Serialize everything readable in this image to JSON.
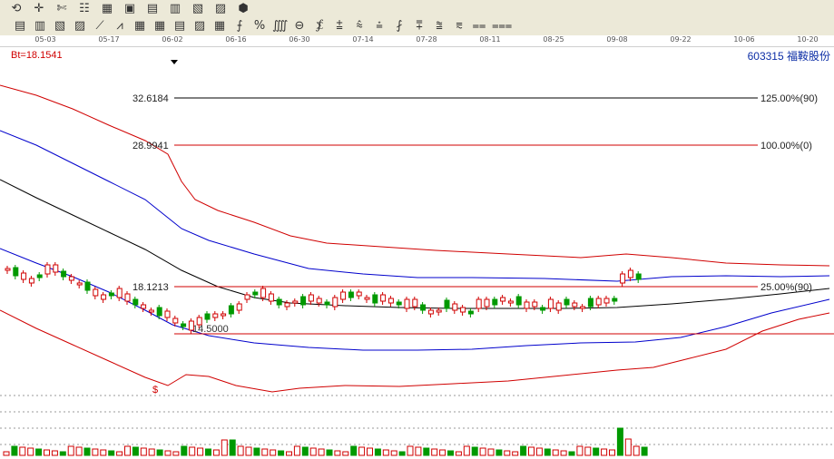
{
  "toolbar": {
    "row1": [
      "⟲",
      "✛",
      "✄",
      "☷",
      "▦",
      "▣",
      "▤",
      "▥",
      "▧",
      "▨",
      "⬢"
    ],
    "row2": [
      "▤",
      "▥",
      "▧",
      "▨",
      "⟋",
      "⩘",
      "▦",
      "▦",
      "▤",
      "▨",
      "▦",
      "⨍",
      "%",
      "⨌",
      "⊖",
      "⨋",
      "⩲",
      "⩯",
      "⩮",
      "⨏",
      "⩱",
      "⩰",
      "⩳",
      "⩵",
      "⩶"
    ]
  },
  "dates": [
    "05-03",
    "05-17",
    "06-02",
    "06-16",
    "06-30",
    "07-14",
    "07-28",
    "08-11",
    "08-25",
    "09-08",
    "09-22",
    "10-06",
    "10-20"
  ],
  "bt_label": "Bt=18.1541",
  "stock": "603315  福鞍股份",
  "colors": {
    "up": "#d00000",
    "down": "#009900",
    "upper": "#d00000",
    "mid": "#0000cc",
    "center": "#000000"
  },
  "chart_data": {
    "type": "candlestick",
    "gann_levels": [
      {
        "price": "32.6184",
        "label": "125.00%(90)"
      },
      {
        "price": "28.9941",
        "label": "100.00%(0)"
      },
      {
        "price": "18.1213",
        "label": "25.00%(90)"
      },
      {
        "price": "14.5000",
        "label": ""
      }
    ],
    "annotation": "$"
  }
}
